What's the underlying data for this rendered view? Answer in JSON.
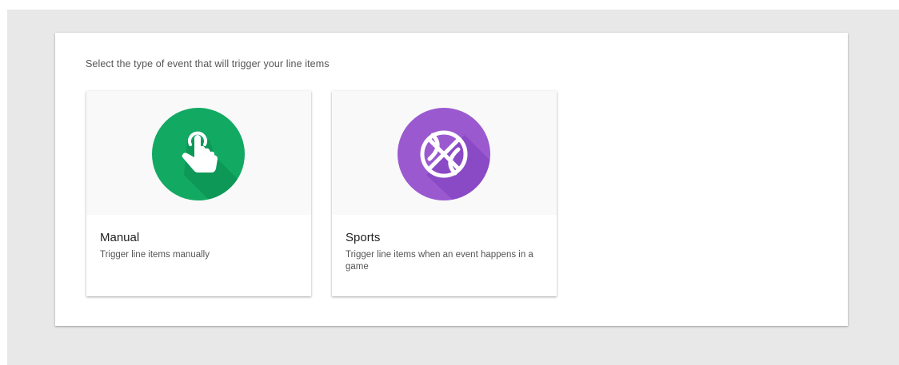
{
  "prompt": "Select the type of event that will trigger your line items",
  "cards": [
    {
      "title": "Manual",
      "description": "Trigger line items manually",
      "icon": "hand-tap-icon",
      "icon_color": "#12a963"
    },
    {
      "title": "Sports",
      "description": "Trigger line items when an event happens in a game",
      "icon": "basketball-icon",
      "icon_color": "#9b59d0"
    }
  ],
  "colors": {
    "backdrop": "#e8e8e8",
    "panel": "#ffffff",
    "card_media": "#f9f9f9"
  }
}
